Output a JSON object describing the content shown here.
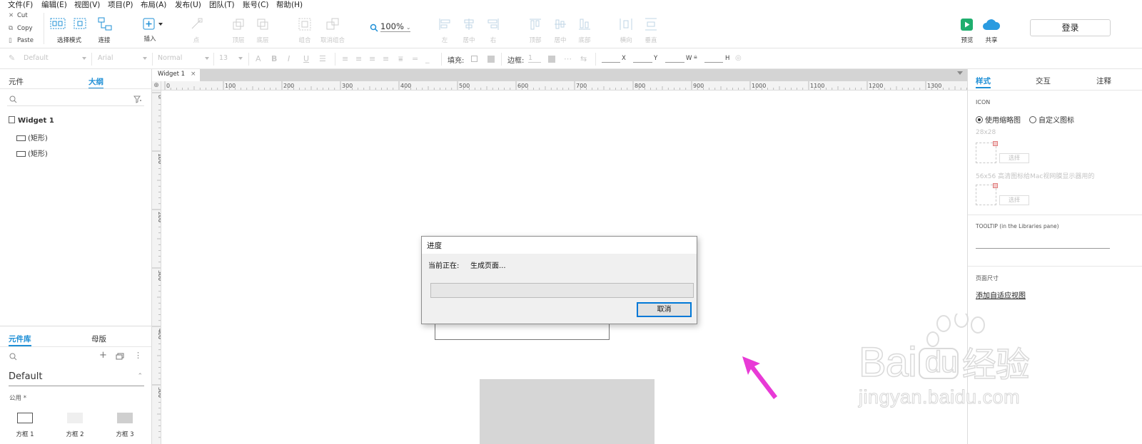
{
  "menu": [
    "文件(F)",
    "编辑(E)",
    "视图(V)",
    "项目(P)",
    "布局(A)",
    "发布(U)",
    "团队(T)",
    "账号(C)",
    "帮助(H)"
  ],
  "clipboard": {
    "cut": "Cut",
    "copy": "Copy",
    "paste": "Paste"
  },
  "toolbar": {
    "select_mode": "选择模式",
    "connect": "连接",
    "insert": "插入",
    "point": "点",
    "top": "顶层",
    "bottom": "底层",
    "group": "组合",
    "ungroup": "取消组合",
    "zoom": "100%",
    "align_left": "左",
    "align_center": "居中",
    "align_right": "右",
    "align_top": "顶部",
    "align_middle": "居中",
    "align_bottom": "底部",
    "horizontal": "横向",
    "vertical": "垂直",
    "preview": "预览",
    "share": "共享",
    "login": "登录"
  },
  "formatbar": {
    "style": "Default",
    "font": "Arial",
    "weight": "Normal",
    "size": "13",
    "fill_label": "填充:",
    "border_label": "边框:",
    "border_value": "1",
    "x": "X",
    "y": "Y",
    "w": "W",
    "h": "H"
  },
  "left": {
    "tab_widgets": "元件",
    "tab_outline": "大纲",
    "outline_root": "Widget 1",
    "outline_items": [
      "(矩形)",
      "(矩形)"
    ],
    "tab_library": "元件库",
    "tab_masters": "母版",
    "library_name": "Default",
    "library_group": "公用 *",
    "library_items": [
      "方框 1",
      "方框 2",
      "方框 3"
    ]
  },
  "canvas": {
    "doc_tab": "Widget 1",
    "ruler_h": [
      "0",
      "100",
      "200",
      "300",
      "400",
      "500",
      "600",
      "700",
      "800",
      "900",
      "1000",
      "1100",
      "1200",
      "1300"
    ],
    "ruler_v": [
      "0",
      "100",
      "200",
      "300",
      "400",
      "500"
    ]
  },
  "right": {
    "tab_style": "样式",
    "tab_interact": "交互",
    "tab_notes": "注释",
    "icon_heading": "ICON",
    "radio_thumb": "使用缩略图",
    "radio_custom": "自定义图标",
    "size_small": "28x28",
    "pick1": "选择",
    "size_large": "56x56 高清图标给Mac视网膜显示器用的",
    "pick2": "选择",
    "tooltip_heading": "TOOLTIP (in the Libraries pane)",
    "page_size_heading": "页面尺寸",
    "adaptive_link": "添加自适应视图"
  },
  "dialog": {
    "title": "进度",
    "status_prefix": "当前正在:",
    "status_value": "生成页面...",
    "progress": 0,
    "cancel": "取消"
  },
  "watermark": {
    "brand": "Bai",
    "brand2": "du",
    "cn": "经验",
    "url": "jingyan.baidu.com"
  },
  "colors": {
    "accent": "#1e8fd6",
    "preview": "#1fae6e",
    "share": "#2a9be0",
    "arrow": "#e83ad6",
    "dialog_border": "#0078d7"
  }
}
